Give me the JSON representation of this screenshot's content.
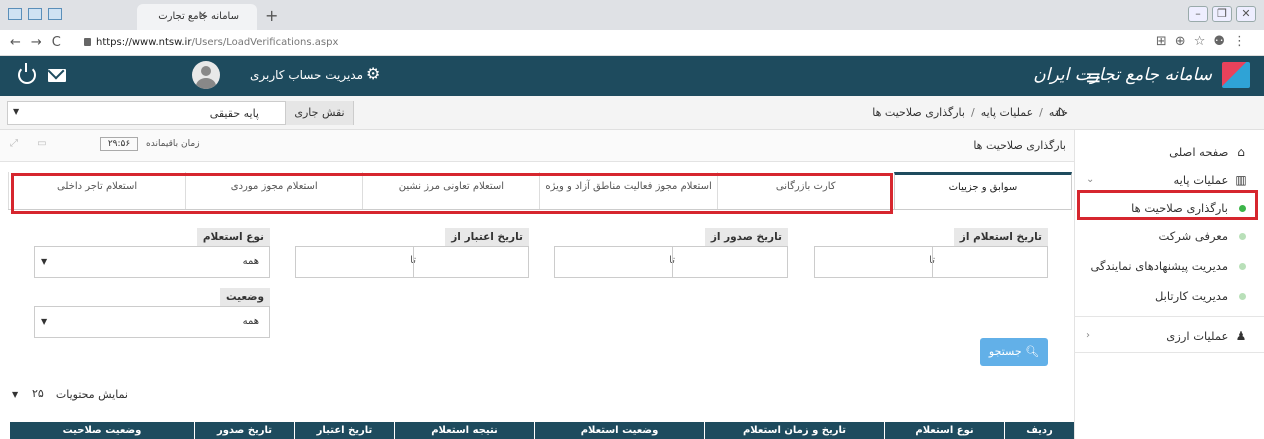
{
  "browser": {
    "tab_title": "سامانه جامع تجارت",
    "url_host": "https://www.ntsw.ir",
    "url_path": "/Users/LoadVerifications.aspx"
  },
  "header": {
    "account_label": "مدیریت حساب کاربری",
    "brand": "سامانه جامع تجارت ایران"
  },
  "breadcrumb": {
    "home": "خانه",
    "level1": "عملیات پایه",
    "level2": "بارگذاری صلاحیت ها",
    "role_label": "نقش جاری",
    "role_value": "پایه حقیقی"
  },
  "pagebar": {
    "title": "بارگذاری صلاحیت ها",
    "timer_label": "زمان باقیمانده",
    "timer_value": "۲۹:۵۶"
  },
  "sidebar": {
    "home": "صفحه اصلی",
    "base_ops": "عملیات پایه",
    "sub_items": [
      "بارگذاری صلاحیت ها",
      "معرفی شرکت",
      "مدیریت پیشنهادهای نمایندگی",
      "مدیریت کارتابل"
    ],
    "fx_ops": "عملیات ارزی"
  },
  "tabs": [
    "سوابق و جزییات",
    "کارت بازرگانی",
    "استعلام مجوز فعالیت مناطق آزاد و ویژه",
    "استعلام تعاونی مرز نشین",
    "استعلام مجوز موردی",
    "استعلام تاجر داخلی"
  ],
  "filters": {
    "inquiry_from": "تاریخ استعلام از",
    "issue_from": "تاریخ صدور از",
    "valid_from": "تاریخ اعتبار از",
    "inquiry_type": "نوع استعلام",
    "inquiry_type_value": "همه",
    "status": "وضعیت",
    "status_value": "همه",
    "to": "تا"
  },
  "search_label": "جستجو",
  "pager": {
    "label": "نمایش محتویات",
    "value": "۲۵"
  },
  "table": {
    "columns": [
      "ردیف",
      "نوع استعلام",
      "تاریخ و زمان استعلام",
      "وضعیت استعلام",
      "نتیجه استعلام",
      "تاریخ اعتبار",
      "تاریخ صدور",
      "وضعیت صلاحیت"
    ]
  },
  "colors": {
    "header_bg": "#1e4b5e",
    "highlight": "#d6262e",
    "search_btn": "#62b0e8",
    "active_dot": "#3cb54a"
  }
}
